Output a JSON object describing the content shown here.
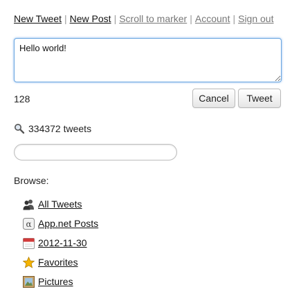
{
  "nav": {
    "new_tweet": "New Tweet",
    "new_post": "New Post",
    "scroll_to_marker": "Scroll to marker",
    "account": "Account",
    "sign_out": "Sign out",
    "separator": "|"
  },
  "compose": {
    "value": "Hello world!",
    "remaining": "128",
    "cancel_label": "Cancel",
    "tweet_label": "Tweet"
  },
  "stats": {
    "tweet_count": "334372 tweets",
    "icon": "magnifier-icon"
  },
  "search": {
    "placeholder": ""
  },
  "browse": {
    "label": "Browse:",
    "items": [
      {
        "label": "All Tweets",
        "icon": "people-icon"
      },
      {
        "label": "App.net Posts",
        "icon": "alpha-icon"
      },
      {
        "label": "2012-11-30",
        "icon": "calendar-icon"
      },
      {
        "label": "Favorites",
        "icon": "star-icon"
      },
      {
        "label": "Pictures",
        "icon": "picture-icon"
      }
    ]
  },
  "colors": {
    "focus_border": "#6aa6e0",
    "star": "#f5b400",
    "calendar_red": "#d23a3a"
  }
}
